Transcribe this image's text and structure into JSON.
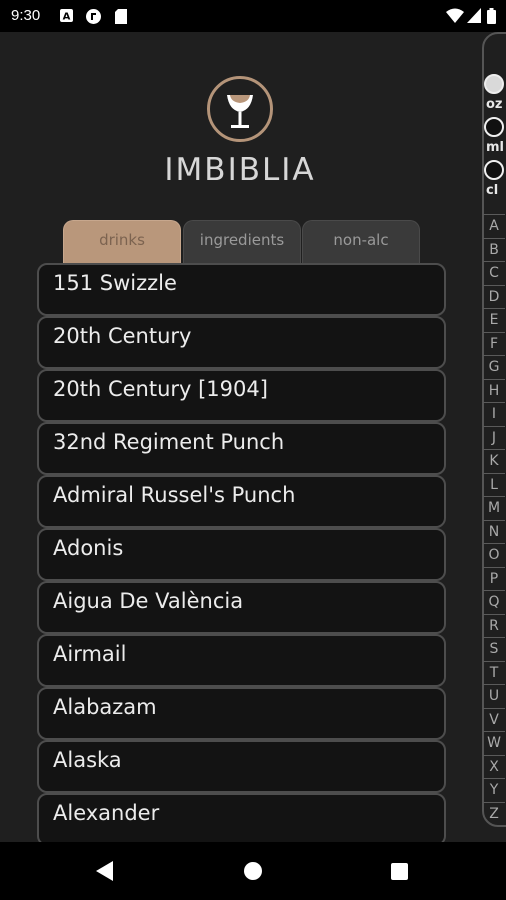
{
  "status_bar": {
    "time": "9:30"
  },
  "app": {
    "title": "IMBIBLIA",
    "logo_icon": "cocktail-glass-icon",
    "tabs": [
      {
        "label": "drinks",
        "active": true
      },
      {
        "label": "ingredients",
        "active": false
      },
      {
        "label": "non-alc",
        "active": false
      }
    ],
    "drinks": [
      "151 Swizzle",
      "20th Century",
      "20th Century [1904]",
      "32nd Regiment Punch",
      "Admiral Russel's Punch",
      "Adonis",
      "Aigua De València",
      "Airmail",
      "Alabazam",
      "Alaska",
      "Alexander"
    ],
    "units": [
      {
        "label": "oz",
        "selected": true
      },
      {
        "label": "ml",
        "selected": false
      },
      {
        "label": "cl",
        "selected": false
      }
    ],
    "alphabet": [
      "A",
      "B",
      "C",
      "D",
      "E",
      "F",
      "G",
      "H",
      "I",
      "J",
      "K",
      "L",
      "M",
      "N",
      "O",
      "P",
      "Q",
      "R",
      "S",
      "T",
      "U",
      "V",
      "W",
      "X",
      "Y",
      "Z"
    ]
  },
  "colors": {
    "accent": "#b9977b",
    "background": "#1f1f1f",
    "list_item_bg": "#131313"
  }
}
